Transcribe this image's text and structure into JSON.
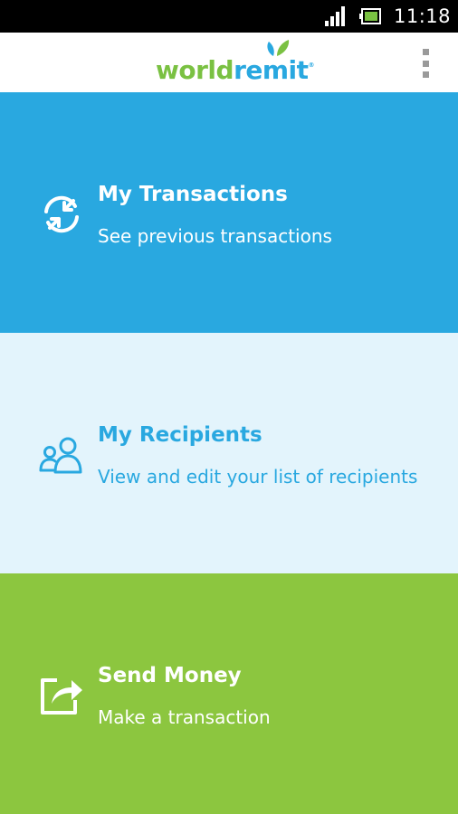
{
  "status_bar": {
    "time": "11:18",
    "icons": [
      "signal-icon",
      "battery-icon"
    ]
  },
  "app_bar": {
    "logo_part1": "world",
    "logo_part2": "remit",
    "logo_mark": "®",
    "menu_icon": "overflow-menu-icon"
  },
  "tiles": [
    {
      "title": "My Transactions",
      "subtitle": "See previous transactions",
      "icon": "transactions-icon",
      "background": "#29a8e0",
      "text_color": "#ffffff"
    },
    {
      "title": "My Recipients",
      "subtitle": "View and edit your list of recipients",
      "icon": "recipients-icon",
      "background": "#e3f4fc",
      "text_color": "#29a8e0"
    },
    {
      "title": "Send Money",
      "subtitle": "Make a transaction",
      "icon": "send-money-icon",
      "background": "#8cc63f",
      "text_color": "#ffffff"
    }
  ],
  "colors": {
    "brand_blue": "#29a8e0",
    "brand_green": "#8cc63f",
    "light_blue": "#e3f4fc"
  }
}
